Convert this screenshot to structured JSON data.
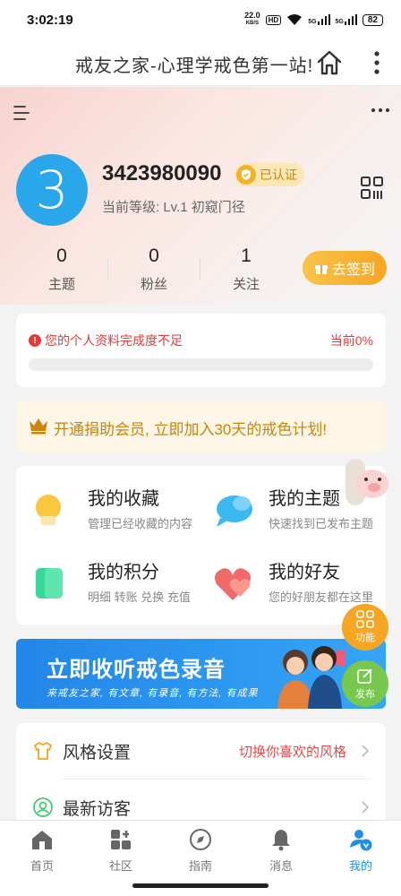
{
  "status": {
    "time": "3:02:19",
    "net_speed_value": "22.0",
    "net_speed_unit": "KB/S",
    "hd": "HD",
    "signal1": "5G",
    "signal2": "5G",
    "battery": "82"
  },
  "header": {
    "title": "戒友之家-心理学戒色第一站!",
    "home_icon": "home-icon",
    "more_icon": "more-vert-icon"
  },
  "profile": {
    "avatar_text": "3",
    "username": "3423980090",
    "verified_label": "已认证",
    "level_text": "当前等级: Lv.1 初窥门径",
    "stats": [
      {
        "value": "0",
        "label": "主题"
      },
      {
        "value": "0",
        "label": "粉丝"
      },
      {
        "value": "1",
        "label": "关注"
      }
    ],
    "checkin_label": "去签到"
  },
  "completion": {
    "warning": "您的个人资料完成度不足",
    "progress_label": "当前0%",
    "progress_fraction": 0
  },
  "vip": {
    "text": "开通捐助会员, 立即加入30天的戒色计划!"
  },
  "grid": [
    {
      "title": "我的收藏",
      "sub": "管理已经收藏的内容"
    },
    {
      "title": "我的主题",
      "sub": "快速找到已发布主题"
    },
    {
      "title": "我的积分",
      "sub": "明细 转账 兑换 充值"
    },
    {
      "title": "我的好友",
      "sub": "您的好朋友都在这里"
    }
  ],
  "fabs": {
    "func_label": "功能",
    "post_label": "发布"
  },
  "banner": {
    "title": "立即收听戒色录音",
    "subtitle": "来戒友之家, 有文章, 有录音, 有方法, 有成果"
  },
  "settings": [
    {
      "label": "风格设置",
      "hint": "切换你喜欢的风格"
    },
    {
      "label": "最新访客",
      "hint": ""
    }
  ],
  "tabs": [
    {
      "label": "首页"
    },
    {
      "label": "社区"
    },
    {
      "label": "指南"
    },
    {
      "label": "消息"
    },
    {
      "label": "我的"
    }
  ],
  "colors": {
    "accent": "#1e90e8",
    "warning": "#e23a3a",
    "gold": "#f6a623",
    "avatar": "#2aa6ea"
  }
}
